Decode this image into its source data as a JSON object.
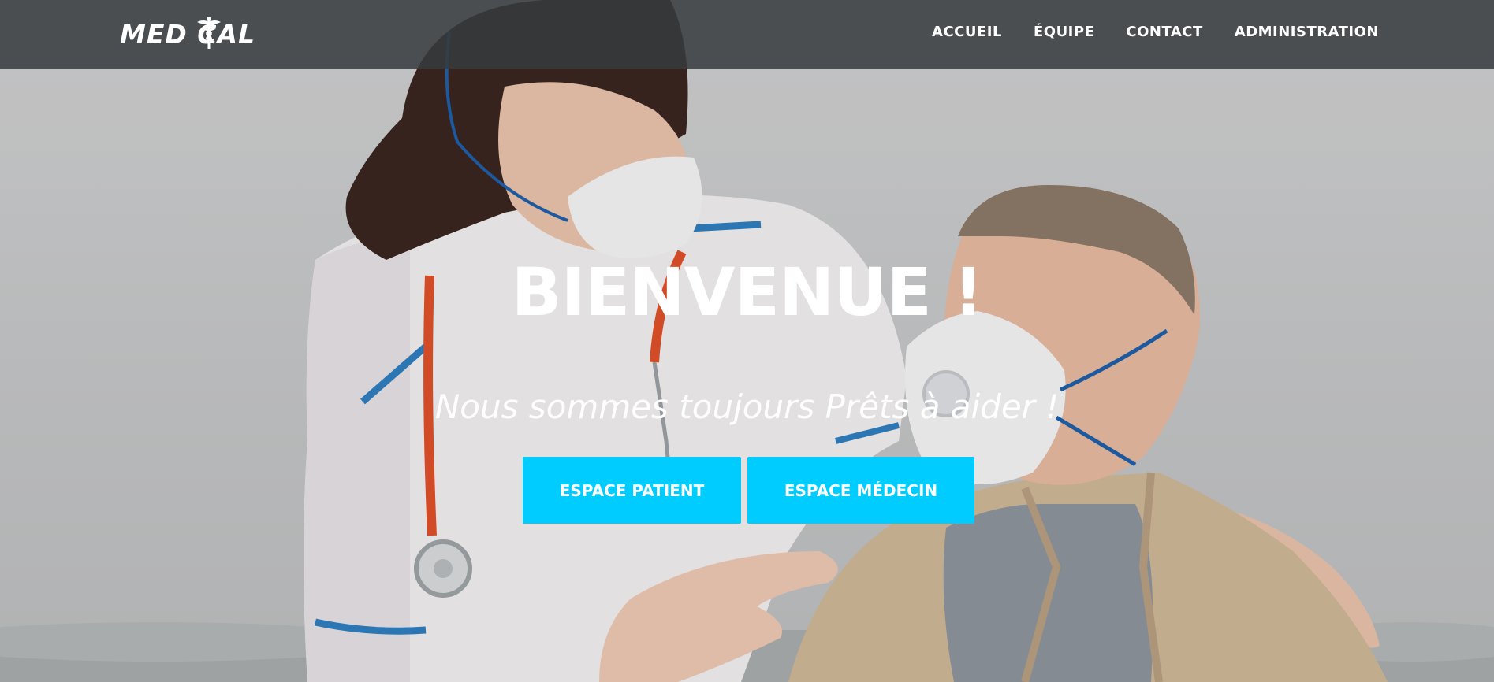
{
  "header": {
    "logo_text": "MED  CAL",
    "logo_icon": "caduceus-icon",
    "nav": [
      {
        "label": "ACCUEIL"
      },
      {
        "label": "ÉQUIPE"
      },
      {
        "label": "CONTACT"
      },
      {
        "label": "ADMINISTRATION"
      }
    ]
  },
  "hero": {
    "title": "BIENVENUE !",
    "subtitle": "Nous sommes toujours Prêts à aider !",
    "buttons": {
      "patient": "ESPACE PATIENT",
      "medecin": "ESPACE MÉDECIN"
    }
  },
  "colors": {
    "navbar_bg": "#373a3e",
    "accent": "#00ccff",
    "text": "#ffffff"
  }
}
